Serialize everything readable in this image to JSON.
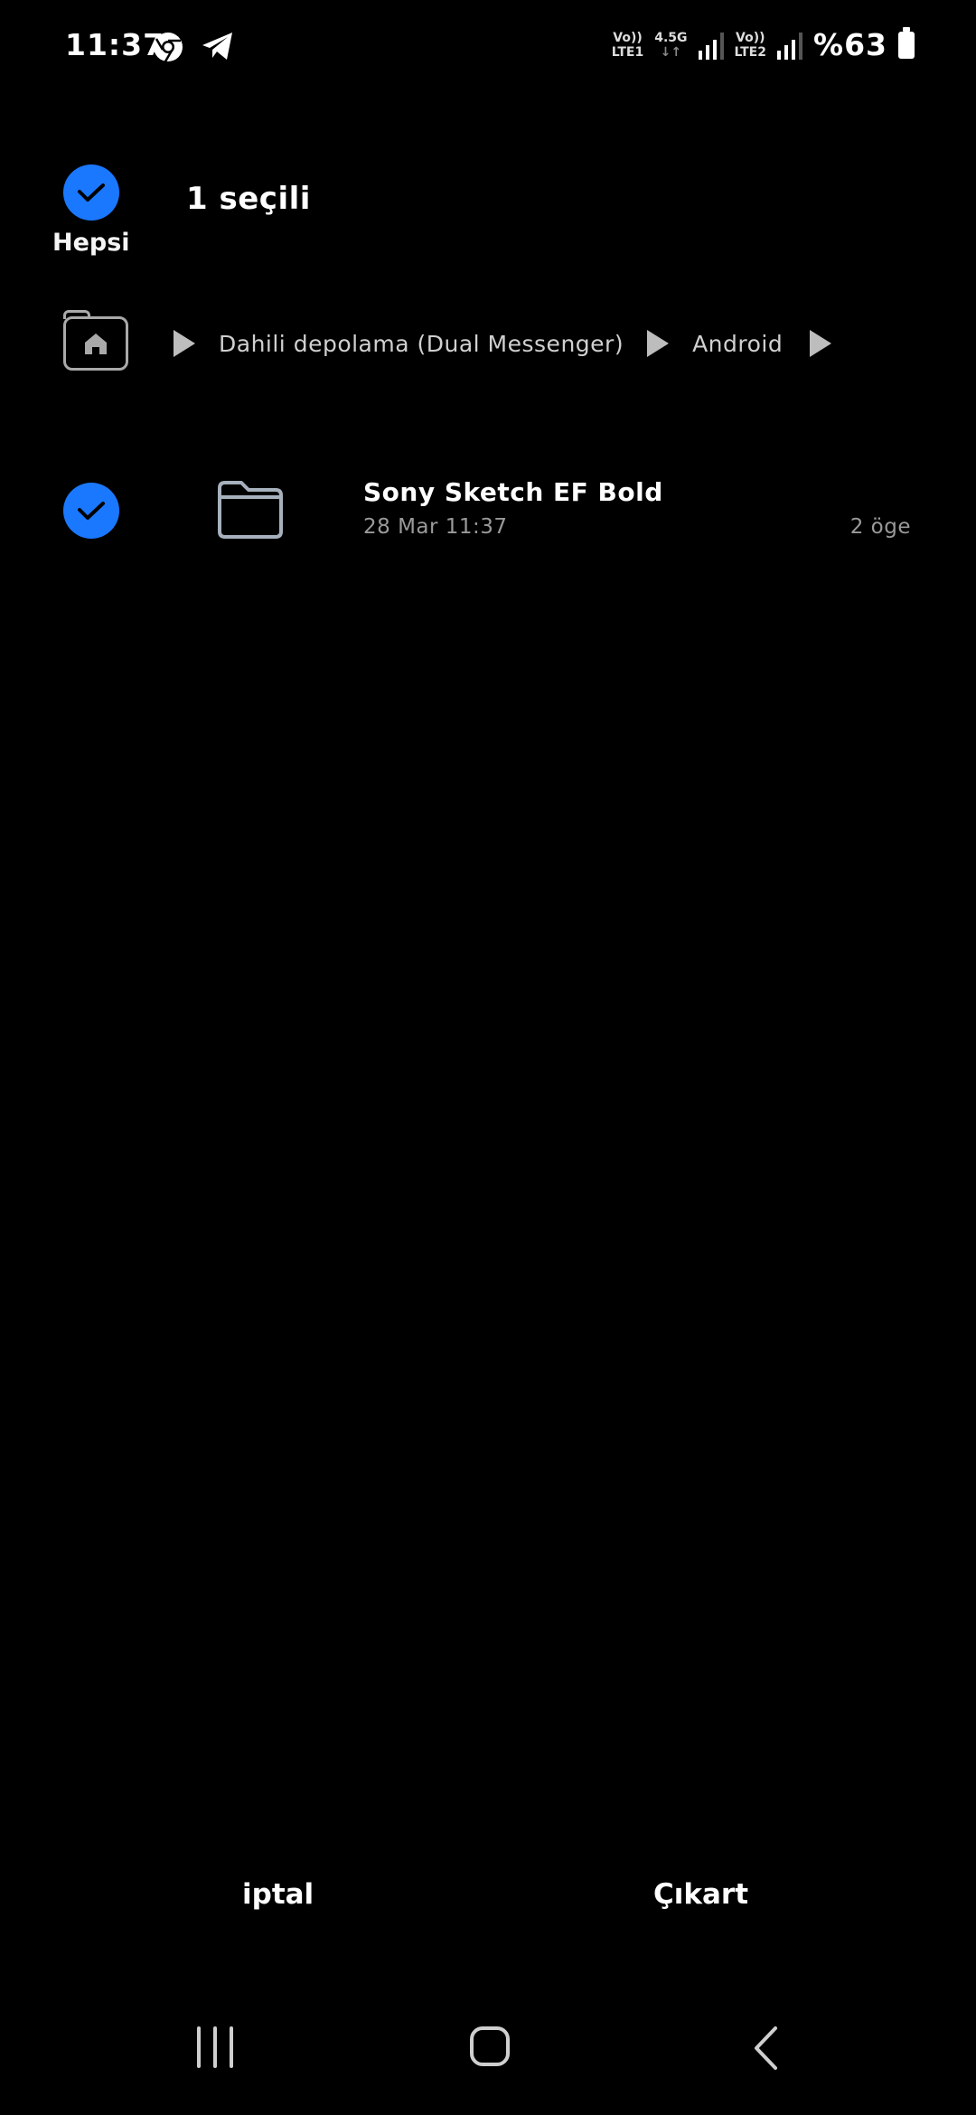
{
  "status_bar": {
    "time": "11:37",
    "notifications": [
      "chrome-icon",
      "telegram-icon"
    ],
    "sim1": {
      "volte": "Vo))",
      "type": "LTE1",
      "net": "4.5G"
    },
    "sim2": {
      "volte": "Vo))",
      "type": "LTE2"
    },
    "battery": "%63"
  },
  "header": {
    "select_all_label": "Hepsi",
    "selected_count": "1 seçili"
  },
  "breadcrumb": {
    "items": [
      "Dahili depolama (Dual Messenger)",
      "Android"
    ]
  },
  "files": [
    {
      "name": "Sony Sketch EF Bold",
      "date": "28 Mar 11:37",
      "count": "2 öge",
      "selected": true
    }
  ],
  "actions": {
    "cancel": "iptal",
    "extract": "Çıkart"
  },
  "colors": {
    "accent": "#1a78ff",
    "background": "#000000",
    "secondary_text": "#9a9a9a"
  }
}
